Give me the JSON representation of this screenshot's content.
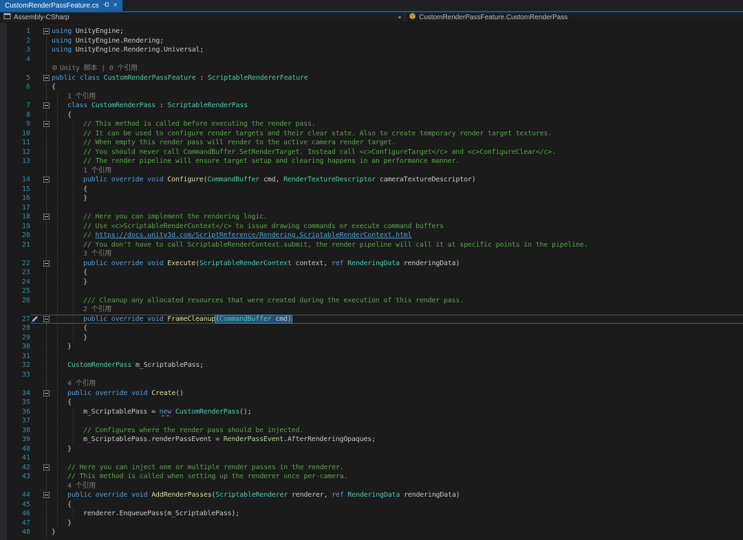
{
  "tab_bar": {
    "active_tab": "CustomRenderPassFeature.cs"
  },
  "nav_bar": {
    "project": "Assembly-CSharp",
    "member": "CustomRenderPassFeature.CustomRenderPass"
  },
  "colors": {
    "editor_bg": "#1b1b1b",
    "margin_bg": "#2a2a2e",
    "tab_active_bg": "#1b62a4",
    "tab_bar_bg": "#202023",
    "tab_accent": "#1a5a96",
    "nav_bg": "#1d1d20",
    "keyword": "#569CD6",
    "type": "#4EC9B0",
    "plain": "#C8C8C8",
    "comment": "#57A64A",
    "method": "#DCDCAA",
    "enum_type": "#B8D7A3",
    "link": "#4F9FCF",
    "codelens": "#7E7E7E",
    "line_number": "#2B91AF",
    "selection_bg": "#264F78",
    "selection_border": "#4E8CC4",
    "current_line_border": "#565656"
  },
  "code": {
    "rows": [
      {
        "n": 1,
        "fold": true,
        "ind": 0,
        "segs": [
          [
            "k",
            "using"
          ],
          [
            "p",
            " UnityEngine;"
          ]
        ]
      },
      {
        "n": 2,
        "ind": 0,
        "segs": [
          [
            "k",
            "using"
          ],
          [
            "p",
            " UnityEngine.Rendering;"
          ]
        ]
      },
      {
        "n": 3,
        "ind": 0,
        "segs": [
          [
            "k",
            "using"
          ],
          [
            "p",
            " UnityEngine.Rendering.Universal;"
          ]
        ]
      },
      {
        "n": 4,
        "ind": 0,
        "segs": []
      },
      {
        "lens": true,
        "gear": true,
        "ind": 0,
        "segs": [
          [
            "G",
            "Unity 脚本 | 0 个引用"
          ]
        ]
      },
      {
        "n": 5,
        "fold": true,
        "ind": 0,
        "segs": [
          [
            "k",
            "public class "
          ],
          [
            "t",
            "CustomRenderPassFeature"
          ],
          [
            "p",
            " : "
          ],
          [
            "t",
            "ScriptableRendererFeature"
          ]
        ]
      },
      {
        "n": 6,
        "ind": 0,
        "segs": [
          [
            "p",
            "{"
          ]
        ]
      },
      {
        "lens": true,
        "ind": 1,
        "segs": [
          [
            "G",
            "1 个引用"
          ]
        ]
      },
      {
        "n": 7,
        "fold": true,
        "ind": 1,
        "segs": [
          [
            "k",
            "class "
          ],
          [
            "t",
            "CustomRenderPass"
          ],
          [
            "p",
            " : "
          ],
          [
            "t",
            "ScriptableRenderPass"
          ]
        ]
      },
      {
        "n": 8,
        "ind": 1,
        "segs": [
          [
            "p",
            "{"
          ]
        ]
      },
      {
        "n": 9,
        "fold": true,
        "ind": 2,
        "segs": [
          [
            "c",
            "// This method is called before executing the render pass."
          ]
        ]
      },
      {
        "n": 10,
        "ind": 2,
        "segs": [
          [
            "c",
            "// It can be used to configure render targets and their clear state. Also to create temporary render target textures."
          ]
        ]
      },
      {
        "n": 11,
        "ind": 2,
        "segs": [
          [
            "c",
            "// When empty this render pass will render to the active camera render target."
          ]
        ]
      },
      {
        "n": 12,
        "ind": 2,
        "segs": [
          [
            "c",
            "// You should never call CommandBuffer.SetRenderTarget. Instead call <c>ConfigureTarget</c> and <c>ConfigureClear</c>."
          ]
        ]
      },
      {
        "n": 13,
        "ind": 2,
        "segs": [
          [
            "c",
            "// The render pipeline will ensure target setup and clearing happens in an performance manner."
          ]
        ]
      },
      {
        "lens": true,
        "ind": 2,
        "segs": [
          [
            "G",
            "1 个引用"
          ]
        ]
      },
      {
        "n": 14,
        "fold": true,
        "ind": 2,
        "segs": [
          [
            "k",
            "public override void "
          ],
          [
            "m",
            "Configure"
          ],
          [
            "p",
            "("
          ],
          [
            "t",
            "CommandBuffer"
          ],
          [
            "p",
            " cmd, "
          ],
          [
            "t",
            "RenderTextureDescriptor"
          ],
          [
            "p",
            " cameraTextureDescriptor)"
          ]
        ]
      },
      {
        "n": 15,
        "ind": 2,
        "segs": [
          [
            "p",
            "{"
          ]
        ]
      },
      {
        "n": 16,
        "ind": 2,
        "segs": [
          [
            "p",
            "}"
          ]
        ]
      },
      {
        "n": 17,
        "ind": 2,
        "segs": []
      },
      {
        "n": 18,
        "fold": true,
        "ind": 2,
        "segs": [
          [
            "c",
            "// Here you can implement the rendering logic."
          ]
        ]
      },
      {
        "n": 19,
        "ind": 2,
        "segs": [
          [
            "c",
            "// Use <c>ScriptableRenderContext</c> to issue drawing commands or execute command buffers"
          ]
        ]
      },
      {
        "n": 20,
        "ind": 2,
        "segs": [
          [
            "c",
            "// "
          ],
          [
            "L",
            "https://docs.unity3d.com/ScriptReference/Rendering.ScriptableRenderContext.html"
          ]
        ]
      },
      {
        "n": 21,
        "ind": 2,
        "segs": [
          [
            "c",
            "// You don't have to call ScriptableRenderContext.submit, the render pipeline will call it at specific points in the pipeline."
          ]
        ]
      },
      {
        "lens": true,
        "ind": 2,
        "segs": [
          [
            "G",
            "3 个引用"
          ]
        ]
      },
      {
        "n": 22,
        "fold": true,
        "ind": 2,
        "segs": [
          [
            "k",
            "public override void "
          ],
          [
            "m",
            "Execute"
          ],
          [
            "p",
            "("
          ],
          [
            "t",
            "ScriptableRenderContext"
          ],
          [
            "p",
            " context, "
          ],
          [
            "k",
            "ref"
          ],
          [
            "p",
            " "
          ],
          [
            "t",
            "RenderingData"
          ],
          [
            "p",
            " renderingData)"
          ]
        ]
      },
      {
        "n": 23,
        "ind": 2,
        "segs": [
          [
            "p",
            "{"
          ]
        ]
      },
      {
        "n": 24,
        "ind": 2,
        "segs": [
          [
            "p",
            "}"
          ]
        ]
      },
      {
        "n": 25,
        "ind": 2,
        "segs": []
      },
      {
        "n": 26,
        "ind": 2,
        "segs": [
          [
            "c",
            "/// Cleanup any allocated resources that were created during the execution of this render pass."
          ]
        ]
      },
      {
        "lens": true,
        "ind": 2,
        "segs": [
          [
            "G",
            "2 个引用"
          ]
        ]
      },
      {
        "n": 27,
        "fold": true,
        "pen": true,
        "cur": true,
        "ind": 2,
        "segs": [
          [
            "k",
            "public override void "
          ],
          [
            "m",
            "FrameCleanup"
          ],
          [
            "sel",
            [
              [
                "p",
                "("
              ],
              [
                "t",
                "CommandBuffer"
              ],
              [
                "p",
                " cmd)"
              ]
            ]
          ]
        ]
      },
      {
        "n": 28,
        "ind": 2,
        "segs": [
          [
            "p",
            "{"
          ]
        ]
      },
      {
        "n": 29,
        "ind": 2,
        "segs": [
          [
            "p",
            "}"
          ]
        ]
      },
      {
        "n": 30,
        "ind": 1,
        "segs": [
          [
            "p",
            "}"
          ]
        ]
      },
      {
        "n": 31,
        "ind": 1,
        "segs": []
      },
      {
        "n": 32,
        "ind": 1,
        "segs": [
          [
            "t",
            "CustomRenderPass"
          ],
          [
            "p",
            " m_ScriptablePass;"
          ]
        ]
      },
      {
        "n": 33,
        "ind": 1,
        "segs": []
      },
      {
        "lens": true,
        "ind": 1,
        "segs": [
          [
            "G",
            "4 个引用"
          ]
        ]
      },
      {
        "n": 34,
        "fold": true,
        "ind": 1,
        "segs": [
          [
            "k",
            "public override void "
          ],
          [
            "m",
            "Create"
          ],
          [
            "p",
            "()"
          ]
        ]
      },
      {
        "n": 35,
        "ind": 1,
        "segs": [
          [
            "p",
            "{"
          ]
        ]
      },
      {
        "n": 36,
        "ind": 2,
        "segs": [
          [
            "p",
            "m_ScriptablePass = "
          ],
          [
            "k",
            "new",
            "squig"
          ],
          [
            "p",
            " "
          ],
          [
            "t",
            "CustomRenderPass"
          ],
          [
            "p",
            "();"
          ]
        ]
      },
      {
        "n": 37,
        "ind": 2,
        "segs": []
      },
      {
        "n": 38,
        "ind": 2,
        "segs": [
          [
            "c",
            "// Configures where the render pass should be injected."
          ]
        ]
      },
      {
        "n": 39,
        "ind": 2,
        "segs": [
          [
            "p",
            "m_ScriptablePass.renderPassEvent = "
          ],
          [
            "e",
            "RenderPassEvent"
          ],
          [
            "p",
            ".AfterRenderingOpaques;"
          ]
        ]
      },
      {
        "n": 40,
        "ind": 1,
        "segs": [
          [
            "p",
            "}"
          ]
        ]
      },
      {
        "n": 41,
        "ind": 1,
        "segs": []
      },
      {
        "n": 42,
        "fold": true,
        "ind": 1,
        "segs": [
          [
            "c",
            "// Here you can inject one or multiple render passes in the renderer."
          ]
        ]
      },
      {
        "n": 43,
        "ind": 1,
        "segs": [
          [
            "c",
            "// This method is called when setting up the renderer once per-camera."
          ]
        ]
      },
      {
        "lens": true,
        "ind": 1,
        "segs": [
          [
            "G",
            "4 个引用"
          ]
        ]
      },
      {
        "n": 44,
        "fold": true,
        "ind": 1,
        "segs": [
          [
            "k",
            "public override void "
          ],
          [
            "m",
            "AddRenderPasses"
          ],
          [
            "p",
            "("
          ],
          [
            "t",
            "ScriptableRenderer"
          ],
          [
            "p",
            " renderer, "
          ],
          [
            "k",
            "ref"
          ],
          [
            "p",
            " "
          ],
          [
            "t",
            "RenderingData"
          ],
          [
            "p",
            " renderingData)"
          ]
        ]
      },
      {
        "n": 45,
        "ind": 1,
        "segs": [
          [
            "p",
            "{"
          ]
        ]
      },
      {
        "n": 46,
        "ind": 2,
        "segs": [
          [
            "p",
            "renderer.EnqueuePass(m_ScriptablePass);"
          ]
        ]
      },
      {
        "n": 47,
        "ind": 1,
        "segs": [
          [
            "p",
            "}"
          ]
        ]
      },
      {
        "n": 48,
        "ind": 0,
        "segs": [
          [
            "p",
            "}"
          ]
        ]
      }
    ]
  }
}
